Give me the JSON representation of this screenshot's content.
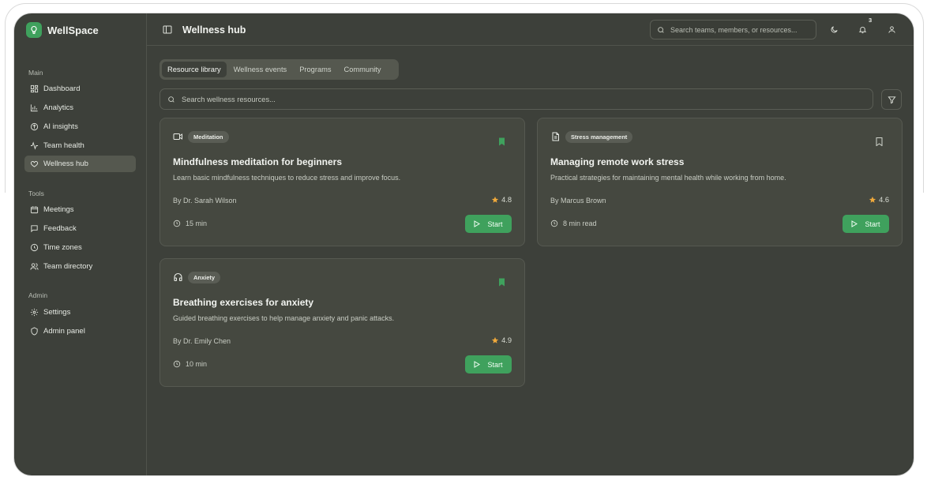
{
  "app": {
    "name": "WellSpace",
    "accent": "#3fa15d"
  },
  "header": {
    "title": "Wellness hub",
    "search_placeholder": "Search teams, members, or resources...",
    "notification_count": "3"
  },
  "sidebar": {
    "groups": [
      {
        "title": "Main",
        "items": [
          {
            "label": "Dashboard",
            "icon": "dashboard-icon"
          },
          {
            "label": "Analytics",
            "icon": "analytics-icon"
          },
          {
            "label": "AI insights",
            "icon": "ai-insights-icon"
          },
          {
            "label": "Team health",
            "icon": "activity-icon"
          },
          {
            "label": "Wellness hub",
            "icon": "heart-icon",
            "active": true
          }
        ]
      },
      {
        "title": "Tools",
        "items": [
          {
            "label": "Meetings",
            "icon": "calendar-icon"
          },
          {
            "label": "Feedback",
            "icon": "message-icon"
          },
          {
            "label": "Time zones",
            "icon": "clock-icon"
          },
          {
            "label": "Team directory",
            "icon": "users-icon"
          }
        ]
      },
      {
        "title": "Admin",
        "items": [
          {
            "label": "Settings",
            "icon": "gear-icon"
          },
          {
            "label": "Admin panel",
            "icon": "shield-icon"
          }
        ]
      }
    ]
  },
  "tabs": [
    {
      "label": "Resource library",
      "active": true
    },
    {
      "label": "Wellness events"
    },
    {
      "label": "Programs"
    },
    {
      "label": "Community"
    }
  ],
  "resource_search": {
    "placeholder": "Search wellness resources..."
  },
  "cards": [
    {
      "category": "Meditation",
      "icon": "video-icon",
      "bookmarked": true,
      "title": "Mindfulness meditation for beginners",
      "description": "Learn basic mindfulness techniques to reduce stress and improve focus.",
      "author": "By Dr. Sarah Wilson",
      "rating": "4.8",
      "duration": "15 min",
      "action": "Start"
    },
    {
      "category": "Stress management",
      "icon": "document-icon",
      "bookmarked": false,
      "title": "Managing remote work stress",
      "description": "Practical strategies for maintaining mental health while working from home.",
      "author": "By Marcus Brown",
      "rating": "4.6",
      "duration": "8 min read",
      "action": "Start"
    },
    {
      "category": "Anxiety",
      "icon": "headphones-icon",
      "bookmarked": true,
      "title": "Breathing exercises for anxiety",
      "description": "Guided breathing exercises to help manage anxiety and panic attacks.",
      "author": "By Dr. Emily Chen",
      "rating": "4.9",
      "duration": "10 min",
      "action": "Start"
    }
  ]
}
